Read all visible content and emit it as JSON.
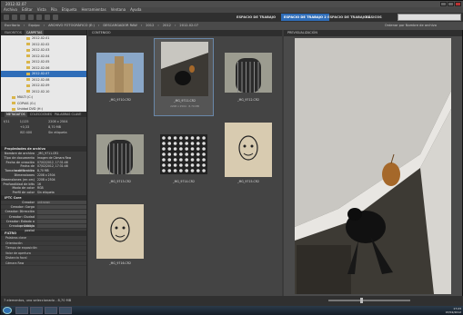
{
  "window": {
    "title": "2012.02.07"
  },
  "menu": [
    "Archivo",
    "Editar",
    "Vista",
    "Pila",
    "Etiqueta",
    "Herramientas",
    "Ventana",
    "Ayuda"
  ],
  "workspaces": [
    {
      "label": "ESPACIO DE TRABAJO",
      "active": false
    },
    {
      "label": "ESPACIO DE TRABAJO 2",
      "active": true
    },
    {
      "label": "ESPACIO DE TRABAJO 1",
      "active": false
    },
    {
      "label": "BÁSICOS",
      "active": false
    }
  ],
  "path": {
    "crumbs": [
      "Escritorio",
      "Equipo",
      "ARCHIVO FOTOGRÁFICO (E:)",
      "DESCARGADOR RAW",
      "2012",
      "2012",
      "2012.02.07"
    ],
    "sort_label": "Ordenar por Nombre de archivo"
  },
  "left": {
    "folders_tab": [
      "FAVORITOS",
      "CARPETAS"
    ],
    "folders": [
      {
        "label": "2012.02.01",
        "indent": 1,
        "selected": false
      },
      {
        "label": "2012.02.02",
        "indent": 1,
        "selected": false
      },
      {
        "label": "2012.02.03",
        "indent": 1,
        "selected": false
      },
      {
        "label": "2012.02.04",
        "indent": 1,
        "selected": false
      },
      {
        "label": "2012.02.05",
        "indent": 1,
        "selected": false
      },
      {
        "label": "2012.02.06",
        "indent": 1,
        "selected": false
      },
      {
        "label": "2012.02.07",
        "indent": 1,
        "selected": true
      },
      {
        "label": "2012.02.08",
        "indent": 1,
        "selected": false
      },
      {
        "label": "2012.02.09",
        "indent": 1,
        "selected": false
      },
      {
        "label": "2012.02.10",
        "indent": 1,
        "selected": false
      },
      {
        "label": "MULTI (C:)",
        "indent": 0,
        "selected": false
      },
      {
        "label": "COPIAS (G:)",
        "indent": 0,
        "selected": false
      },
      {
        "label": "Unidad DVD (H:)",
        "indent": 0,
        "selected": false
      }
    ],
    "meta_tabs": [
      "METADATOS",
      "COLECCIONES",
      "PALABRAS CLAVE"
    ],
    "meta_summary": [
      [
        "f/11",
        "1/125",
        "2208 x 2504"
      ],
      [
        "",
        "+0,33",
        "8,70 MB"
      ],
      [
        "",
        "ISO 400",
        "Sin etiqueta"
      ]
    ],
    "props_title": "Propiedades de archivo",
    "props": [
      {
        "k": "Nombre de archivo",
        "v": "_MG_9711.CR2"
      },
      {
        "k": "Tipo de documento",
        "v": "Imagen de Cámara Raw"
      },
      {
        "k": "Fecha de creación",
        "v": "07/02/2012, 17:31:46"
      },
      {
        "k": "Fecha de modificación",
        "v": "07/02/2012, 17:31:46"
      },
      {
        "k": "Tamaño de archivo",
        "v": "8,70 MB"
      },
      {
        "k": "Dimensiones",
        "v": "2208 x 2504"
      },
      {
        "k": "Dimensiones (en cm)",
        "v": "2208 x 2504"
      },
      {
        "k": "Profundidad de bits",
        "v": "16"
      },
      {
        "k": "Modo de color",
        "v": "RGB"
      },
      {
        "k": "Perfil de color",
        "v": "Sin etiqueta"
      }
    ],
    "iptc_title": "IPTC Core",
    "iptc": [
      {
        "k": "Creador",
        "v": "unknown"
      },
      {
        "k": "Creador: Cargo",
        "v": ""
      },
      {
        "k": "Creador: Dirección",
        "v": ""
      },
      {
        "k": "Creador: Ciudad",
        "v": ""
      },
      {
        "k": "Creador: Estado o provincia",
        "v": ""
      },
      {
        "k": "Creador: Código postal",
        "v": ""
      }
    ],
    "filter_title": "FILTRO",
    "filters": [
      "Palabras clave",
      "Orientación",
      "Tiempo de exposición",
      "Valor de apertura",
      "Distancia focal",
      "Cámara Raw"
    ]
  },
  "content": {
    "tab": "CONTENIDO",
    "thumbs": [
      {
        "name": "_MG_9710.CR2",
        "sub": "",
        "selected": false,
        "kind": "building"
      },
      {
        "name": "_MG_9711.CR2",
        "sub": "2208 x 2504 · 8,70 MB",
        "selected": true,
        "kind": "bird"
      },
      {
        "name": "_MG_9712.CR2",
        "sub": "",
        "selected": false,
        "kind": "gate"
      },
      {
        "name": "_MG_9713.CR2",
        "sub": "",
        "selected": false,
        "kind": "gate2"
      },
      {
        "name": "_MG_9714.CR2",
        "sub": "",
        "selected": false,
        "kind": "pattern"
      },
      {
        "name": "_MG_9715.CR2",
        "sub": "",
        "selected": false,
        "kind": "face"
      },
      {
        "name": "_MG_9716.CR2",
        "sub": "",
        "selected": false,
        "kind": "face2"
      }
    ]
  },
  "preview": {
    "tab": "PREVISUALIZACIÓN"
  },
  "status": {
    "text": "7 elementos, uno seleccionado - 8,70 MB"
  },
  "taskbar": {
    "time": "17:23",
    "date": "07/02/2012"
  }
}
